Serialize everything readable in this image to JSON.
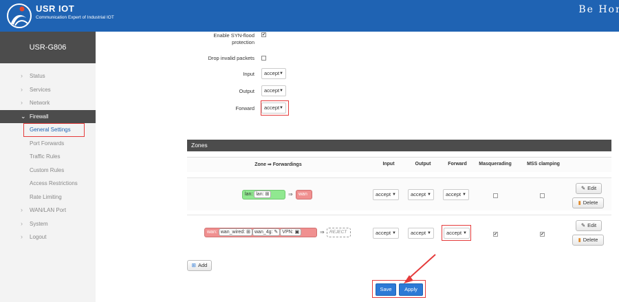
{
  "header": {
    "brand": "USR IOT",
    "tagline": "Communication Expert of Industrial IOT",
    "slogan": "Be Hon"
  },
  "sidebar": {
    "model": "USR-G806",
    "items": [
      {
        "label": "Status"
      },
      {
        "label": "Services"
      },
      {
        "label": "Network"
      },
      {
        "label": "Firewall"
      },
      {
        "label": "General Settings"
      },
      {
        "label": "Port Forwards"
      },
      {
        "label": "Traffic Rules"
      },
      {
        "label": "Custom Rules"
      },
      {
        "label": "Access Restrictions"
      },
      {
        "label": "Rate Limiting"
      },
      {
        "label": "WAN/LAN Port"
      },
      {
        "label": "System"
      },
      {
        "label": "Logout"
      }
    ]
  },
  "general": {
    "syn_flood_label": "Enable SYN-flood protection",
    "syn_flood_checked": "✔",
    "drop_invalid_label": "Drop invalid packets",
    "input_label": "Input",
    "input_value": "accept",
    "output_label": "Output",
    "output_value": "accept",
    "forward_label": "Forward",
    "forward_value": "accept"
  },
  "zones": {
    "title": "Zones",
    "columns": [
      "Zone ⇒ Forwardings",
      "Input",
      "Output",
      "Forward",
      "Masquerading",
      "MSS clamping"
    ],
    "rows": [
      {
        "zone": "lan:",
        "networks": [
          "lan:"
        ],
        "arrow": "⇒",
        "dest": "wan",
        "input": "accept",
        "output": "accept",
        "forward": "accept",
        "masq": "",
        "mss": ""
      },
      {
        "zone": "wan:",
        "networks": [
          "wan_wired:",
          "wan_4g:",
          "VPN:"
        ],
        "arrow": "⇒",
        "dest": "REJECT",
        "input": "accept",
        "output": "accept",
        "forward": "accept",
        "masq": "✔",
        "mss": "✔"
      }
    ],
    "edit_label": "Edit",
    "delete_label": "Delete",
    "add_label": "Add"
  },
  "actions": {
    "save_label": "Save",
    "apply_label": "Apply"
  },
  "colors": {
    "header_bg": "#1f63b3",
    "sidebar_active": "#4c4c4c",
    "highlight": "#e53a3a",
    "lan_green": "#90e890",
    "wan_red": "#f09090"
  }
}
